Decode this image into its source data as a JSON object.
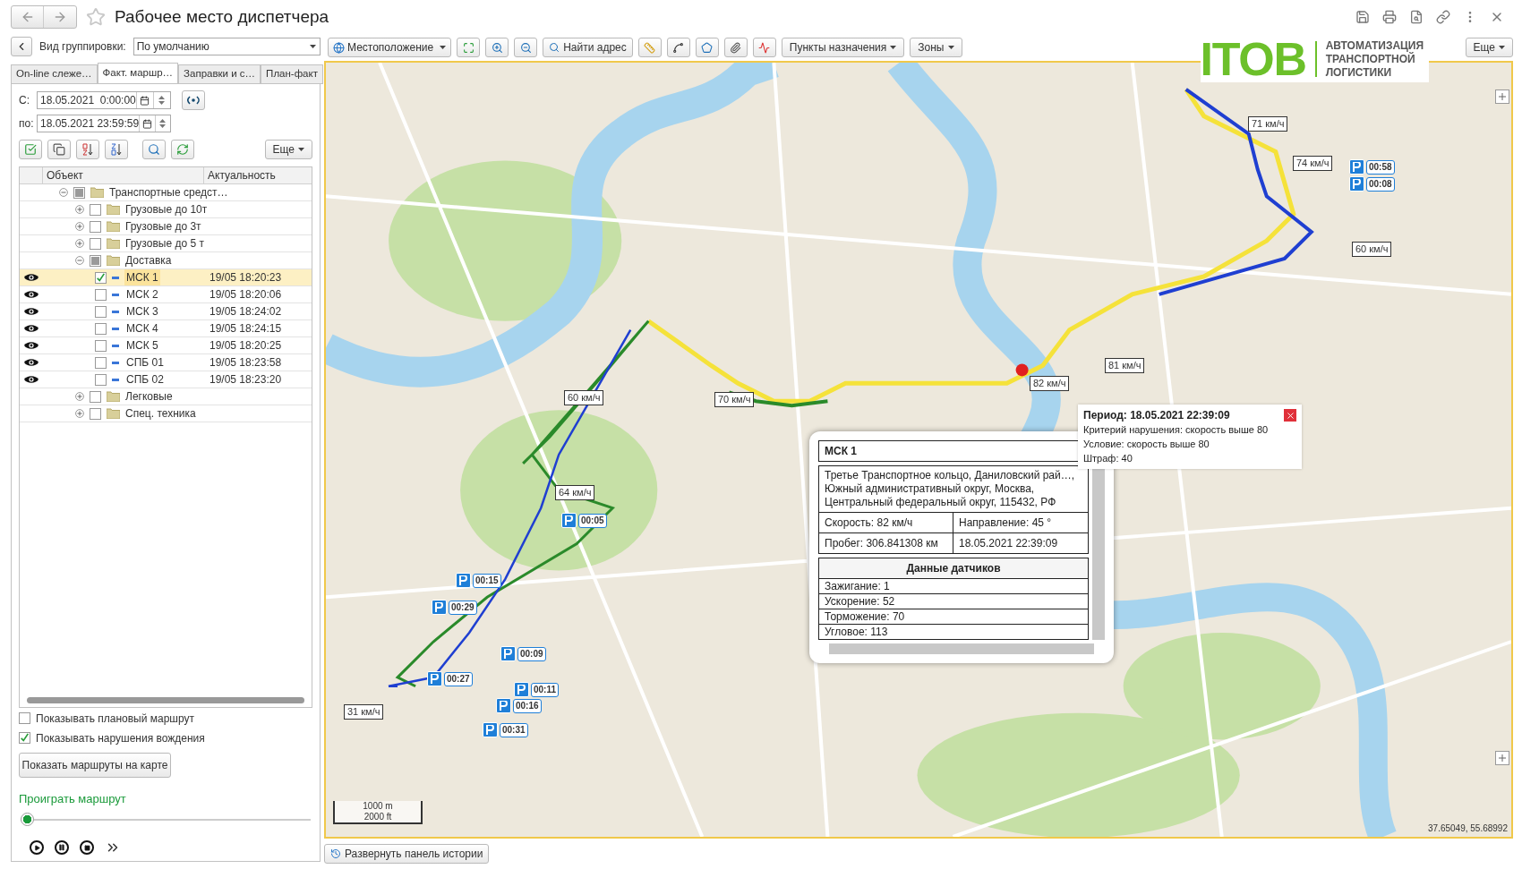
{
  "window": {
    "title": "Рабочее место диспетчера",
    "favorite": false
  },
  "grouping": {
    "label": "Вид группировки:",
    "value": "По умолчанию"
  },
  "tabs": [
    {
      "label": "On-line слеже…",
      "selected": false
    },
    {
      "label": "Факт. маршр…",
      "selected": true
    },
    {
      "label": "Заправки и с…",
      "selected": false
    },
    {
      "label": "План-факт",
      "selected": false
    }
  ],
  "period": {
    "from_label": "С:",
    "from": "18.05.2021  0:00:00",
    "to_label": "по:",
    "to": "18.05.2021 23:59:59"
  },
  "list_more": "Еще",
  "tree": {
    "columns": [
      "Объект",
      "Актуальность"
    ],
    "items": [
      {
        "kind": "folder",
        "label": "Транспортные средст…",
        "checked": false,
        "partial": true,
        "expanded": true,
        "children": [
          {
            "kind": "folder",
            "label": "Грузовые до 10т",
            "checked": false,
            "partial": false,
            "expanded": false
          },
          {
            "kind": "folder",
            "label": "Грузовые до 3т",
            "checked": false,
            "partial": false,
            "expanded": false
          },
          {
            "kind": "folder",
            "label": "Грузовые до 5 т",
            "checked": false,
            "partial": false,
            "expanded": false
          },
          {
            "kind": "folder",
            "label": "Доставка",
            "checked": false,
            "partial": true,
            "expanded": true,
            "children": [
              {
                "kind": "vehicle",
                "label": "МСК 1",
                "time": "19/05 18:20:23",
                "checked": true,
                "visible": true,
                "selected": true
              },
              {
                "kind": "vehicle",
                "label": "МСК 2",
                "time": "19/05 18:20:06",
                "checked": false,
                "visible": true,
                "selected": false
              },
              {
                "kind": "vehicle",
                "label": "МСК 3",
                "time": "19/05 18:24:02",
                "checked": false,
                "visible": true,
                "selected": false
              },
              {
                "kind": "vehicle",
                "label": "МСК 4",
                "time": "19/05 18:24:15",
                "checked": false,
                "visible": true,
                "selected": false
              },
              {
                "kind": "vehicle",
                "label": "МСК 5",
                "time": "19/05 18:20:25",
                "checked": false,
                "visible": true,
                "selected": false
              },
              {
                "kind": "vehicle",
                "label": "СПБ 01",
                "time": "19/05 18:23:58",
                "checked": false,
                "visible": true,
                "selected": false
              },
              {
                "kind": "vehicle",
                "label": "СПБ 02",
                "time": "19/05 18:23:20",
                "checked": false,
                "visible": true,
                "selected": false
              }
            ]
          },
          {
            "kind": "folder",
            "label": "Легковые",
            "checked": false,
            "partial": false,
            "expanded": false
          },
          {
            "kind": "folder",
            "label": "Спец. техника",
            "checked": false,
            "partial": false,
            "expanded": false
          }
        ]
      }
    ]
  },
  "options": [
    {
      "label": "Показывать плановый маршрут",
      "checked": false
    },
    {
      "label": "Показывать нарушения вождения",
      "checked": true
    }
  ],
  "show_button": "Показать маршруты на карте",
  "playback": {
    "title": "Проиграть маршрут",
    "level": 0
  },
  "map_toolbar": {
    "location": "Местоположение",
    "find": "Найти адрес",
    "destinations": "Пункты назначения",
    "zones": "Зоны",
    "more": "Еще"
  },
  "logo": {
    "mark": "ITOB",
    "tagline": [
      "АВТОМАТИЗАЦИЯ",
      "ТРАНСПОРТНОЙ",
      "ЛОГИСТИКИ"
    ]
  },
  "map": {
    "speed_labels": [
      "71 км/ч",
      "74 км/ч",
      "60 км/ч",
      "82 км/ч",
      "81 км/ч",
      "60 км/ч",
      "70 км/ч",
      "64 км/ч",
      "31 км/ч"
    ],
    "stops": [
      "00:58",
      "00:08",
      "00:05",
      "00:15",
      "00:29",
      "00:27",
      "00:09",
      "00:11",
      "00:16",
      "00:31"
    ],
    "scale": [
      "1000 m",
      "2000 ft"
    ],
    "coordinates": "37.65049, 55.68992"
  },
  "popup": {
    "title": "МСК 1",
    "address": "Третье Транспортное кольцо, Даниловский рай…, Южный административный округ, Москва, Центральный федеральный округ, 115432, РФ",
    "speed": "Скорость: 82 км/ч",
    "direction": "Направление: 45 °",
    "mileage": "Пробег: 306.841308 км",
    "time": "18.05.2021 22:39:09",
    "sensors_title": "Данные датчиков",
    "sensors": [
      "Зажигание: 1",
      "Ускорение: 52",
      "Торможение: 70",
      "Угловое: 113"
    ]
  },
  "violation": {
    "period": "Период: 18.05.2021 22:39:09",
    "lines": [
      "Критерий нарушения: скорость выше 80",
      "Условие: скорость выше 80",
      "Штраф: 40"
    ]
  },
  "history_button": "Развернуть панель истории"
}
